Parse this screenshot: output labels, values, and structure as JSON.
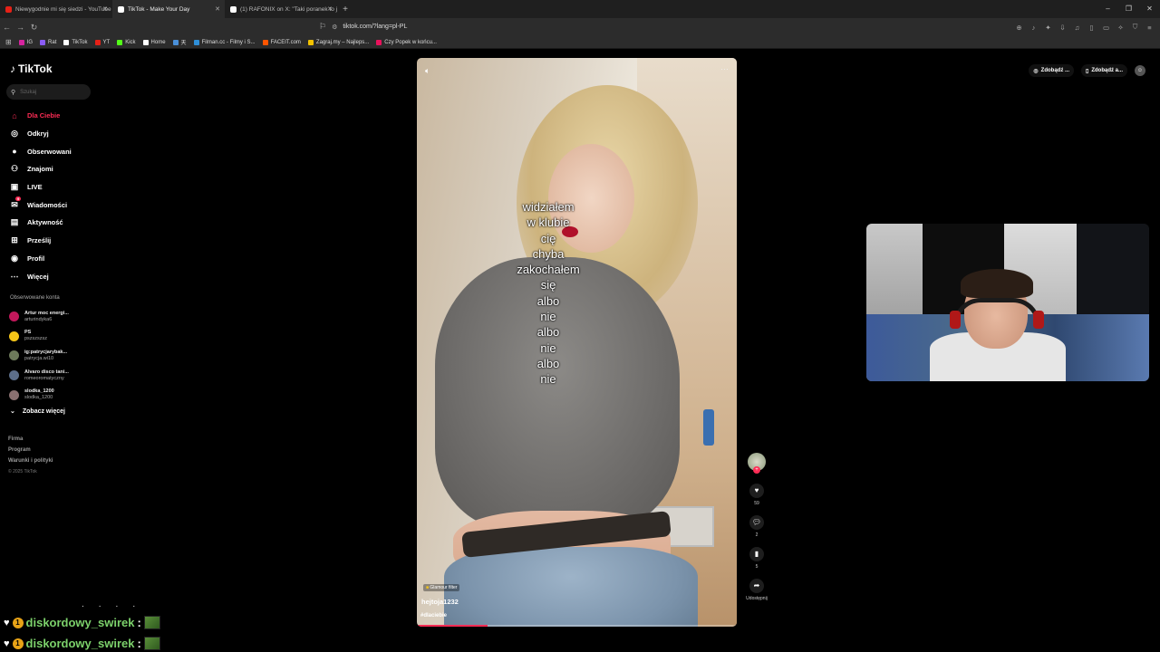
{
  "browser": {
    "tabs": [
      {
        "title": "Niewygodnie mi się siedzi - YouTube",
        "favicon_color": "#e62117",
        "active": false
      },
      {
        "title": "TikTok - Make Your Day",
        "favicon_color": "#ffffff",
        "active": true
      },
      {
        "title": "(1) RAFONIX on X: \"Taki poranek to j",
        "favicon_color": "#ffffff",
        "active": false
      }
    ],
    "new_tab": "+",
    "url": "tiktok.com/?lang=pl-PL",
    "bookmarks": [
      {
        "label": "IG",
        "color": "#d6249f"
      },
      {
        "label": "Rat",
        "color": "#8a5cf6"
      },
      {
        "label": "TikTok",
        "color": "#ffffff"
      },
      {
        "label": "YT",
        "color": "#e62117"
      },
      {
        "label": "Kick",
        "color": "#53fc18"
      },
      {
        "label": "Home",
        "color": "#ffffff"
      },
      {
        "label": "天",
        "color": "#4a90d9"
      },
      {
        "label": "Filman.cc - Filmy i S...",
        "color": "#2f8fd8"
      },
      {
        "label": "FACEIT.com",
        "color": "#ff5500"
      },
      {
        "label": "Zagraj.my – Najleps...",
        "color": "#f2c200"
      },
      {
        "label": "Czy Popek w końcu...",
        "color": "#e8125c"
      }
    ]
  },
  "tiktok": {
    "logo": "TikTok",
    "search_placeholder": "Szukaj",
    "nav": [
      {
        "label": "Dla Ciebie",
        "icon": "home-icon",
        "glyph": "⌂",
        "active": true
      },
      {
        "label": "Odkryj",
        "icon": "compass-icon",
        "glyph": "◎",
        "active": false
      },
      {
        "label": "Obserwowani",
        "icon": "following-avatar-icon",
        "glyph": "●",
        "active": false
      },
      {
        "label": "Znajomi",
        "icon": "friends-icon",
        "glyph": "⚇",
        "active": false
      },
      {
        "label": "LIVE",
        "icon": "live-icon",
        "glyph": "▣",
        "active": false
      },
      {
        "label": "Wiadomości",
        "icon": "messages-icon",
        "glyph": "✉",
        "active": false,
        "badge": "9"
      },
      {
        "label": "Aktywność",
        "icon": "activity-icon",
        "glyph": "▤",
        "active": false
      },
      {
        "label": "Prześlij",
        "icon": "upload-icon",
        "glyph": "⊞",
        "active": false
      },
      {
        "label": "Profil",
        "icon": "profile-icon",
        "glyph": "◉",
        "active": false
      },
      {
        "label": "Więcej",
        "icon": "more-icon",
        "glyph": "⋯",
        "active": false
      }
    ],
    "followed_title": "Obserwowane konta",
    "followed": [
      {
        "name": "Artur moc energi...",
        "handle": "arturindyka6",
        "color": "#c2185b"
      },
      {
        "name": "PS",
        "handle": "pszszszsz",
        "color": "#f5c518"
      },
      {
        "name": "ig:patrycjarybak...",
        "handle": "patrycja.wi10",
        "color": "#6d7a5a"
      },
      {
        "name": "Alvaro disco tani...",
        "handle": "romeoromatyczny",
        "color": "#5c6e8a"
      },
      {
        "name": "slodka_1200",
        "handle": "slodka_1200",
        "color": "#8a7070"
      }
    ],
    "see_more": "Zobacz więcej",
    "footer": [
      "Firma",
      "Program",
      "Warunki i polityki"
    ],
    "copyright": "© 2025 TikTok",
    "top_right": {
      "get_app_1": "Zdobądź ...",
      "get_app_2": "Zdobądź a..."
    }
  },
  "video": {
    "caption_lines": [
      "widziałem",
      "w klubie",
      "cię",
      "chyba",
      "zakochałem",
      "się",
      "albo",
      "nie",
      "albo",
      "nie",
      "albo",
      "nie"
    ],
    "filter": "Glamour filter",
    "author": "hejtoja1232",
    "hashtag": "#dlaciebie",
    "progress": 0.22,
    "likes": "59",
    "comments": "2",
    "saves": "5",
    "share_label": "Udostępnij"
  },
  "chat": [
    {
      "user": "diskordowy_swirek",
      "sep": ":"
    },
    {
      "user": "diskordowy_swirek",
      "sep": ":"
    }
  ]
}
